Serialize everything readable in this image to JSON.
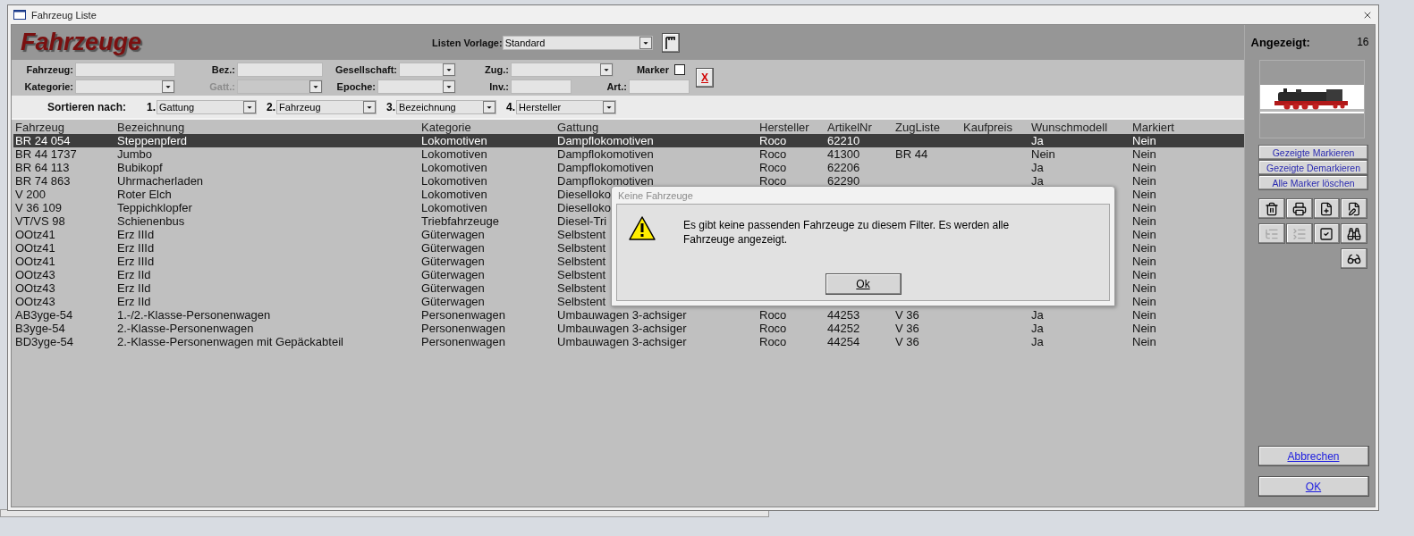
{
  "window": {
    "title": "Fahrzeug Liste"
  },
  "header": {
    "title": "Fahrzeuge",
    "template_label": "Listen Vorlage:",
    "template_value": "Standard"
  },
  "filters": [
    [
      {
        "label": "Fahrzeug:",
        "kind": "input",
        "disabled": false
      },
      {
        "label": "Bez.:",
        "kind": "input",
        "disabled": false
      },
      {
        "label": "Gesellschaft:",
        "kind": "select",
        "disabled": false
      },
      {
        "label": "Zug.:",
        "kind": "select",
        "disabled": false
      },
      {
        "label": "Marker",
        "kind": "checkbox",
        "checked": false
      }
    ],
    [
      {
        "label": "Kategorie:",
        "kind": "select",
        "disabled": false
      },
      {
        "label": "Gatt.:",
        "kind": "select",
        "disabled": true
      },
      {
        "label": "Epoche:",
        "kind": "select",
        "disabled": false
      },
      {
        "label": "Inv.:",
        "kind": "input",
        "disabled": false
      },
      {
        "label": "Art.:",
        "kind": "input",
        "disabled": false
      }
    ]
  ],
  "clear_button": "X",
  "sort": {
    "label": "Sortieren nach:",
    "keys": [
      {
        "number": "1.",
        "value": "Gattung"
      },
      {
        "number": "2.",
        "value": "Fahrzeug"
      },
      {
        "number": "3.",
        "value": "Bezeichnung"
      },
      {
        "number": "4.",
        "value": "Hersteller"
      }
    ]
  },
  "counter": {
    "label": "Angezeigt:",
    "value": "16"
  },
  "photo": {
    "kind": "picture"
  },
  "mark_buttons": [
    "Gezeigte Markieren",
    "Gezeigte Demarkieren",
    "Alle Marker löschen"
  ],
  "tools": [
    [
      {
        "kind": "trash",
        "disabled": false
      },
      {
        "kind": "print",
        "disabled": false
      },
      {
        "kind": "new",
        "disabled": false
      },
      {
        "kind": "edit",
        "disabled": false
      }
    ],
    [
      {
        "kind": "expand",
        "disabled": true
      },
      {
        "kind": "collapse",
        "disabled": true
      },
      {
        "kind": "check",
        "disabled": false
      },
      {
        "kind": "find",
        "disabled": false
      }
    ],
    [
      {
        "kind": "glasses",
        "disabled": false
      }
    ]
  ],
  "table": {
    "columns": [
      "Fahrzeug",
      "Bezeichnung",
      "Kategorie",
      "Gattung",
      "Hersteller",
      "ArtikelNr",
      "ZugListe",
      "Kaufpreis",
      "Wunschmodell",
      "Markiert"
    ],
    "rows": [
      {
        "selected": true,
        "cells": [
          "BR 24 054",
          "Steppenpferd",
          "Lokomotiven",
          "Dampflokomotiven",
          "Roco",
          "62210",
          null,
          null,
          "Ja",
          "Nein"
        ]
      },
      {
        "selected": false,
        "cells": [
          "BR 44 1737",
          "Jumbo",
          "Lokomotiven",
          "Dampflokomotiven",
          "Roco",
          "41300",
          "BR 44",
          null,
          "Nein",
          "Nein"
        ]
      },
      {
        "selected": false,
        "cells": [
          "BR 64 113",
          "Bubikopf",
          "Lokomotiven",
          "Dampflokomotiven",
          "Roco",
          "62206",
          null,
          null,
          "Ja",
          "Nein"
        ]
      },
      {
        "selected": false,
        "cells": [
          "BR 74 863",
          "Uhrmacherladen",
          "Lokomotiven",
          "Dampflokomotiven",
          "Roco",
          "62290",
          null,
          null,
          "Ja",
          "Nein"
        ]
      },
      {
        "selected": false,
        "cells": [
          "V 200",
          "Roter Elch",
          "Lokomotiven",
          "Dieselloko",
          null,
          null,
          null,
          null,
          null,
          "Nein"
        ]
      },
      {
        "selected": false,
        "cells": [
          "V 36 109",
          "Teppichklopfer",
          "Lokomotiven",
          "Dieselloko",
          null,
          null,
          null,
          null,
          null,
          "Nein"
        ]
      },
      {
        "selected": false,
        "cells": [
          "VT/VS 98",
          "Schienenbus",
          "Triebfahrzeuge",
          "Diesel-Tri",
          null,
          null,
          null,
          null,
          null,
          "Nein"
        ]
      },
      {
        "selected": false,
        "cells": [
          "OOtz41",
          "Erz IIId",
          "Güterwagen",
          "Selbstent",
          null,
          null,
          null,
          null,
          null,
          "Nein"
        ]
      },
      {
        "selected": false,
        "cells": [
          "OOtz41",
          "Erz IIId",
          "Güterwagen",
          "Selbstent",
          null,
          null,
          null,
          null,
          null,
          "Nein"
        ]
      },
      {
        "selected": false,
        "cells": [
          "OOtz41",
          "Erz IIId",
          "Güterwagen",
          "Selbstent",
          null,
          null,
          null,
          null,
          null,
          "Nein"
        ]
      },
      {
        "selected": false,
        "cells": [
          "OOtz43",
          "Erz IId",
          "Güterwagen",
          "Selbstent",
          null,
          null,
          null,
          null,
          null,
          "Nein"
        ]
      },
      {
        "selected": false,
        "cells": [
          "OOtz43",
          "Erz IId",
          "Güterwagen",
          "Selbstent",
          null,
          null,
          null,
          null,
          null,
          "Nein"
        ]
      },
      {
        "selected": false,
        "cells": [
          "OOtz43",
          "Erz IId",
          "Güterwagen",
          "Selbstent",
          null,
          null,
          null,
          null,
          null,
          "Nein"
        ]
      },
      {
        "selected": false,
        "cells": [
          "AB3yge-54",
          "1.-/2.-Klasse-Personenwagen",
          "Personenwagen",
          "Umbauwagen 3-achsiger",
          "Roco",
          "44253",
          "V 36",
          null,
          "Ja",
          "Nein"
        ]
      },
      {
        "selected": false,
        "cells": [
          "B3yge-54",
          "2.-Klasse-Personenwagen",
          "Personenwagen",
          "Umbauwagen 3-achsiger",
          "Roco",
          "44252",
          "V 36",
          null,
          "Ja",
          "Nein"
        ]
      },
      {
        "selected": false,
        "cells": [
          "BD3yge-54",
          "2.-Klasse-Personenwagen mit Gepäckabteil",
          "Personenwagen",
          "Umbauwagen 3-achsiger",
          "Roco",
          "44254",
          "V 36",
          null,
          "Ja",
          "Nein"
        ]
      }
    ]
  },
  "dialog": {
    "title": "Keine Fahrzeuge",
    "message": "Es gibt keine passenden Fahrzeuge zu diesem Filter. Es werden alle Fahrzeuge angezeigt.",
    "button": "Ok"
  },
  "buttons": [
    "Abbrechen",
    "OK"
  ]
}
